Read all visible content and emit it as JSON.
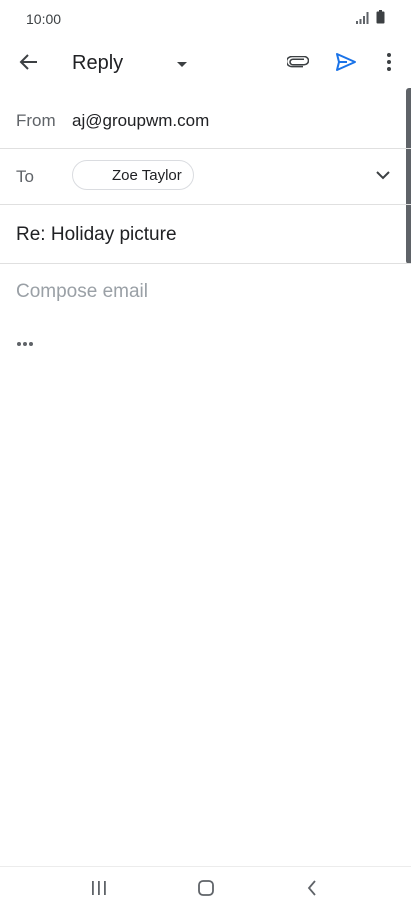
{
  "status_bar": {
    "time": "10:00",
    "icons": [
      "signal-icon",
      "battery-icon"
    ]
  },
  "app_bar": {
    "title": "Reply",
    "icons": [
      "back-arrow-icon",
      "dropdown-caret-icon",
      "paperclip-icon",
      "send-icon",
      "more-vert-icon"
    ]
  },
  "compose": {
    "from_label": "From",
    "from_value": "aj@groupwm.com",
    "to_label": "To",
    "to_recipient": "Zoe Taylor",
    "subject": "Re: Holiday picture",
    "body_placeholder": "Compose email"
  },
  "nav_bar": {
    "icons": [
      "recent-apps-icon",
      "home-icon",
      "back-icon"
    ]
  },
  "colors": {
    "accent": "#1a73e8",
    "icon_gray": "#5f6368",
    "placeholder": "#9aa0a6"
  }
}
